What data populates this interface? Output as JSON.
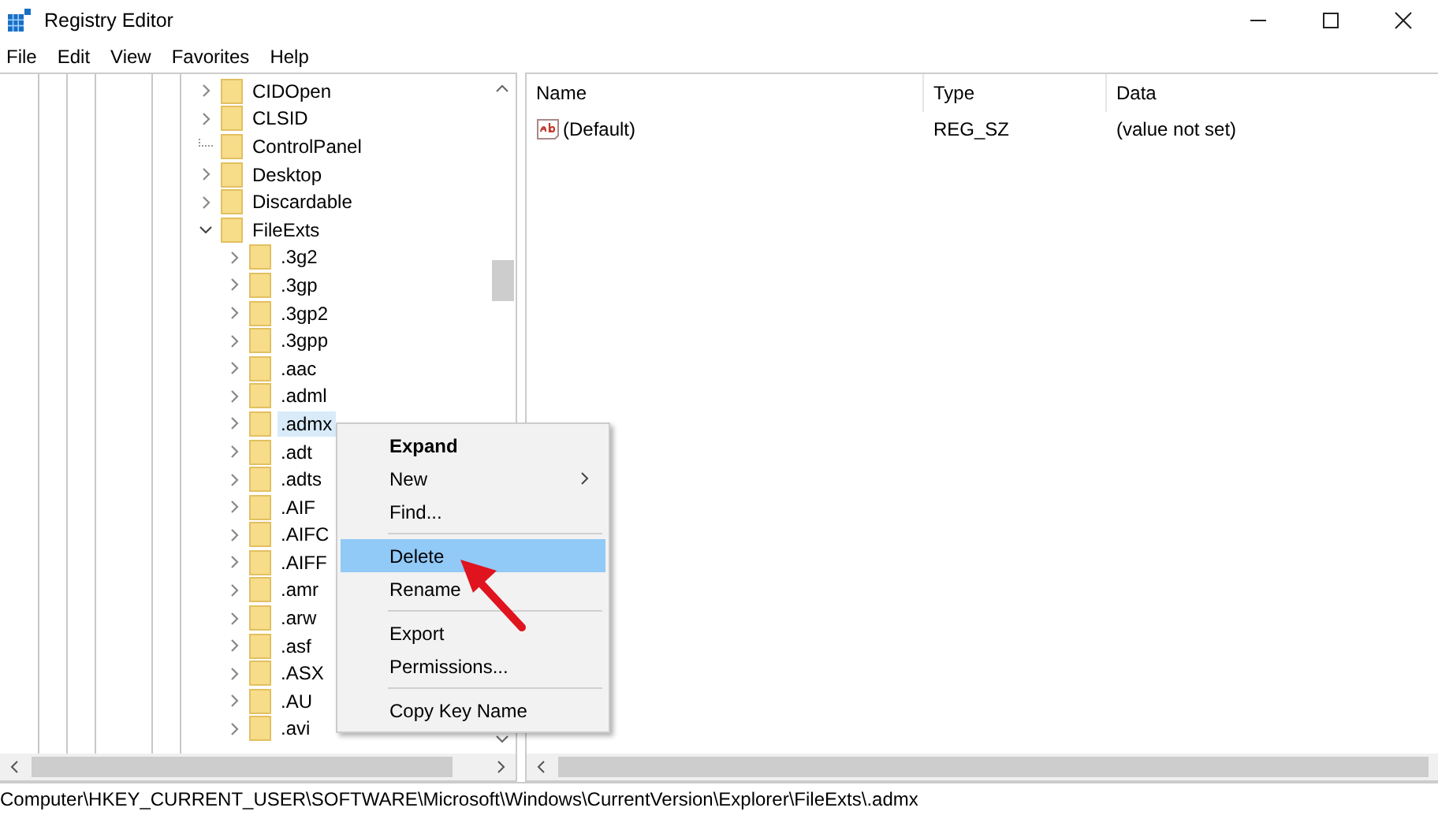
{
  "window": {
    "title": "Registry Editor"
  },
  "menu": [
    "File",
    "Edit",
    "View",
    "Favorites",
    "Help"
  ],
  "tree": [
    {
      "kind": "branch",
      "label": "CIDOpen",
      "expanded": false,
      "selected": false
    },
    {
      "kind": "branch",
      "label": "CLSID",
      "expanded": false,
      "selected": false
    },
    {
      "kind": "leaf",
      "label": "ControlPanel",
      "selected": false
    },
    {
      "kind": "branch",
      "label": "Desktop",
      "expanded": false,
      "selected": false
    },
    {
      "kind": "branch",
      "label": "Discardable",
      "expanded": false,
      "selected": false
    },
    {
      "kind": "branch",
      "label": "FileExts",
      "expanded": true,
      "selected": false,
      "children": [
        {
          "kind": "branch",
          "label": ".3g2",
          "expanded": false,
          "selected": false
        },
        {
          "kind": "branch",
          "label": ".3gp",
          "expanded": false,
          "selected": false
        },
        {
          "kind": "branch",
          "label": ".3gp2",
          "expanded": false,
          "selected": false
        },
        {
          "kind": "branch",
          "label": ".3gpp",
          "expanded": false,
          "selected": false
        },
        {
          "kind": "branch",
          "label": ".aac",
          "expanded": false,
          "selected": false
        },
        {
          "kind": "branch",
          "label": ".adml",
          "expanded": false,
          "selected": false
        },
        {
          "kind": "branch",
          "label": ".admx",
          "expanded": false,
          "selected": true
        },
        {
          "kind": "branch",
          "label": ".adt",
          "expanded": false,
          "selected": false
        },
        {
          "kind": "branch",
          "label": ".adts",
          "expanded": false,
          "selected": false
        },
        {
          "kind": "branch",
          "label": ".AIF",
          "expanded": false,
          "selected": false
        },
        {
          "kind": "branch",
          "label": ".AIFC",
          "expanded": false,
          "selected": false
        },
        {
          "kind": "branch",
          "label": ".AIFF",
          "expanded": false,
          "selected": false
        },
        {
          "kind": "branch",
          "label": ".amr",
          "expanded": false,
          "selected": false
        },
        {
          "kind": "branch",
          "label": ".arw",
          "expanded": false,
          "selected": false
        },
        {
          "kind": "branch",
          "label": ".asf",
          "expanded": false,
          "selected": false
        },
        {
          "kind": "branch",
          "label": ".ASX",
          "expanded": false,
          "selected": false
        },
        {
          "kind": "branch",
          "label": ".AU",
          "expanded": false,
          "selected": false
        },
        {
          "kind": "branch",
          "label": ".avi",
          "expanded": false,
          "selected": false
        }
      ]
    }
  ],
  "values": {
    "columns": [
      "Name",
      "Type",
      "Data"
    ],
    "rows": [
      {
        "name": "(Default)",
        "type": "REG_SZ",
        "data": "(value not set)"
      }
    ]
  },
  "context_menu": {
    "items": [
      {
        "kind": "item",
        "label": "Expand",
        "default": true,
        "submenu": false,
        "selected": false
      },
      {
        "kind": "item",
        "label": "New",
        "default": false,
        "submenu": true,
        "selected": false
      },
      {
        "kind": "item",
        "label": "Find...",
        "default": false,
        "submenu": false,
        "selected": false
      },
      {
        "kind": "separator"
      },
      {
        "kind": "item",
        "label": "Delete",
        "default": false,
        "submenu": false,
        "selected": true
      },
      {
        "kind": "item",
        "label": "Rename",
        "default": false,
        "submenu": false,
        "selected": false
      },
      {
        "kind": "separator"
      },
      {
        "kind": "item",
        "label": "Export",
        "default": false,
        "submenu": false,
        "selected": false
      },
      {
        "kind": "item",
        "label": "Permissions...",
        "default": false,
        "submenu": false,
        "selected": false
      },
      {
        "kind": "separator"
      },
      {
        "kind": "item",
        "label": "Copy Key Name",
        "default": false,
        "submenu": false,
        "selected": false
      }
    ]
  },
  "status_bar": "Computer\\HKEY_CURRENT_USER\\SOFTWARE\\Microsoft\\Windows\\CurrentVersion\\Explorer\\FileExts\\.admx"
}
